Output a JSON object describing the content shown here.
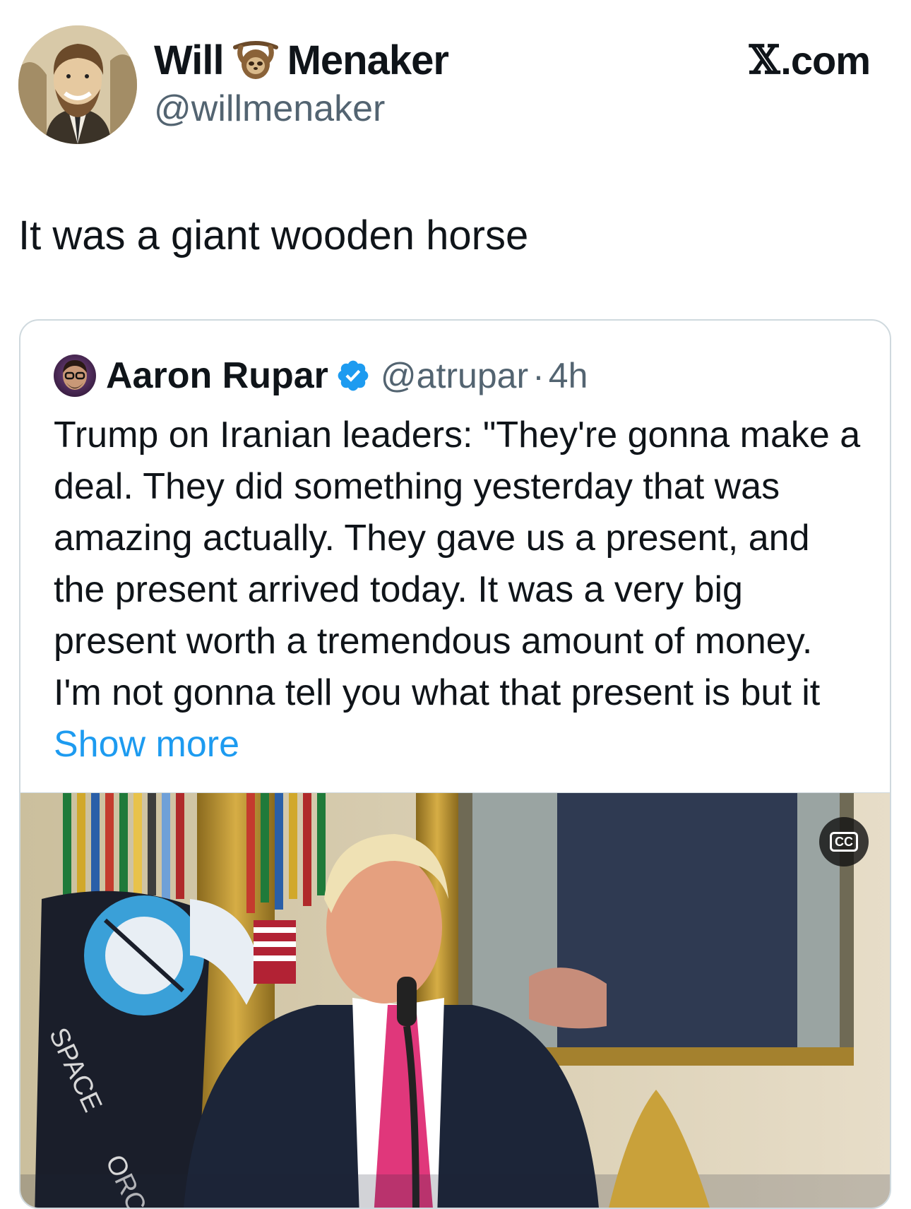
{
  "author": {
    "name_first": "Will",
    "name_last": "Menaker",
    "handle": "@willmenaker",
    "avatar_icon": "comic-portrait-avatar",
    "name_emoji_icon": "sloth-emoji-icon"
  },
  "watermark": {
    "glyph": "𝕏",
    "text": ".com"
  },
  "tweet": {
    "text": "It was a giant wooden horse"
  },
  "quoted": {
    "name": "Aaron Rupar",
    "handle": "@atrupar",
    "separator": "·",
    "time": "4h",
    "verified_icon": "verified-badge-icon",
    "body": "Trump on Iranian leaders: \"They're gonna make a deal. They did something yesterday that was amazing actually. They gave us a present, and the present arrived today. It was a very big present worth a tremendous amount of money. I'm not gonna tell you what that present is but it ",
    "show_more": "Show more",
    "media": {
      "cc_label": "CC",
      "flag_text": "SPACE",
      "flag_text_2": "ORC"
    }
  },
  "colors": {
    "text": "#0f1419",
    "secondary": "#536471",
    "link": "#1d9bf0",
    "border": "#cfd9de",
    "verified": "#1d9bf0"
  }
}
